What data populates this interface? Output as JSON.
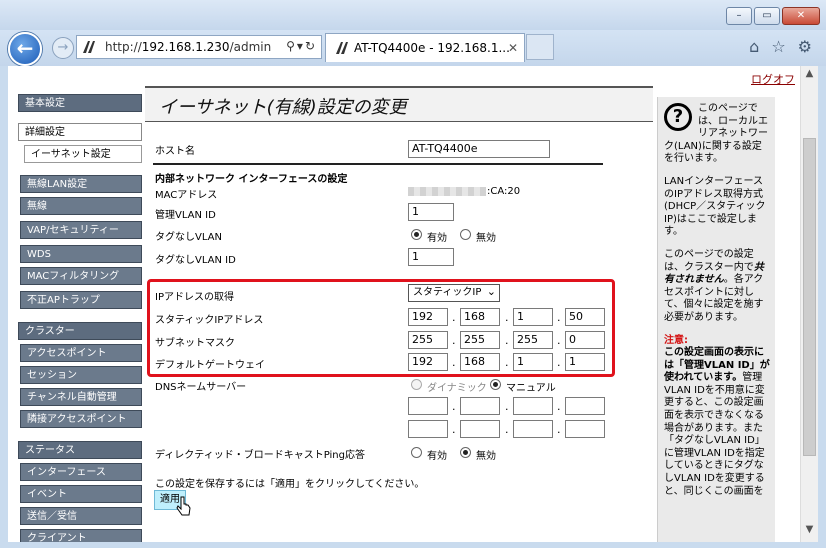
{
  "browser": {
    "url_prefix": "http://",
    "url_host": "192.168.1.230",
    "url_path": "/admin",
    "tab_title": "AT-TQ4400e - 192.168.1...",
    "back_icon": "back-arrow-icon",
    "forward_icon": "forward-arrow-icon"
  },
  "page": {
    "logout": "ログオフ",
    "title": "イーサネット(有線)設定の変更"
  },
  "sidebar": {
    "basic": "基本設定",
    "advanced": "詳細設定",
    "ethernet": "イーサネット設定",
    "wlan": "無線LAN設定",
    "wireless": "無線",
    "vap": "VAP/セキュリティー",
    "wds": "WDS",
    "mac": "MACフィルタリング",
    "rogue": "不正APトラップ",
    "cluster": "クラスター",
    "ap": "アクセスポイント",
    "session": "セッション",
    "channel": "チャンネル自動管理",
    "neighbor": "隣接アクセスポイント",
    "status": "ステータス",
    "iface": "インターフェース",
    "event": "イベント",
    "txrx": "送信／受信",
    "client": "クライアント"
  },
  "form": {
    "hostname_label": "ホスト名",
    "hostname_value": "AT-TQ4400e",
    "internal_section": "内部ネットワーク インターフェースの設定",
    "mac_label": "MACアドレス",
    "mac_suffix": ":CA:20",
    "mgmt_vlan_label": "管理VLAN ID",
    "mgmt_vlan_value": "1",
    "untagged_label": "タグなしVLAN",
    "enabled": "有効",
    "disabled": "無効",
    "untagged_id_label": "タグなしVLAN ID",
    "untagged_id_value": "1",
    "ip_get_label": "IPアドレスの取得",
    "ip_get_value": "スタティックIP",
    "static_ip_label": "スタティックIPアドレス",
    "ip": [
      "192",
      "168",
      "1",
      "50"
    ],
    "subnet_label": "サブネットマスク",
    "mask": [
      "255",
      "255",
      "255",
      "0"
    ],
    "gateway_label": "デフォルトゲートウェイ",
    "gw": [
      "192",
      "168",
      "1",
      "1"
    ],
    "dns_label": "DNSネームサーバー",
    "dynamic": "ダイナミック",
    "manual": "マニュアル",
    "ping_label": "ディレクティッド・ブロードキャストPing応答",
    "save_note": "この設定を保存するには「適用」をクリックしてください。",
    "apply": "適用"
  },
  "help": {
    "p1": "このページでは、ローカルエリアネットワーク(LAN)に関する設定を行います。",
    "p2": "LANインターフェースのIPアドレス取得方式(DHCP／スタティックIP)はここで設定します。",
    "p3a": "このページでの設定は、クラスター内で",
    "p3b": "共有されません",
    "p3c": "。各アクセスポイントに対して、個々に設定を施す必要があります。",
    "note_title": "注意:",
    "note_bold": "この設定画面の表示には「管理VLAN ID」が使われています。",
    "note_text": "管理VLAN IDを不用意に変更すると、この設定画面を表示できなくなる場合があります。また「タグなしVLAN ID」に管理VLAN IDを指定しているときにタグなしVLAN IDを変更すると、同じくこの画面を"
  },
  "colors": {
    "highlight": "#e0121c",
    "sidebar": "#5d6c7f",
    "apply": "#bfeffc"
  }
}
